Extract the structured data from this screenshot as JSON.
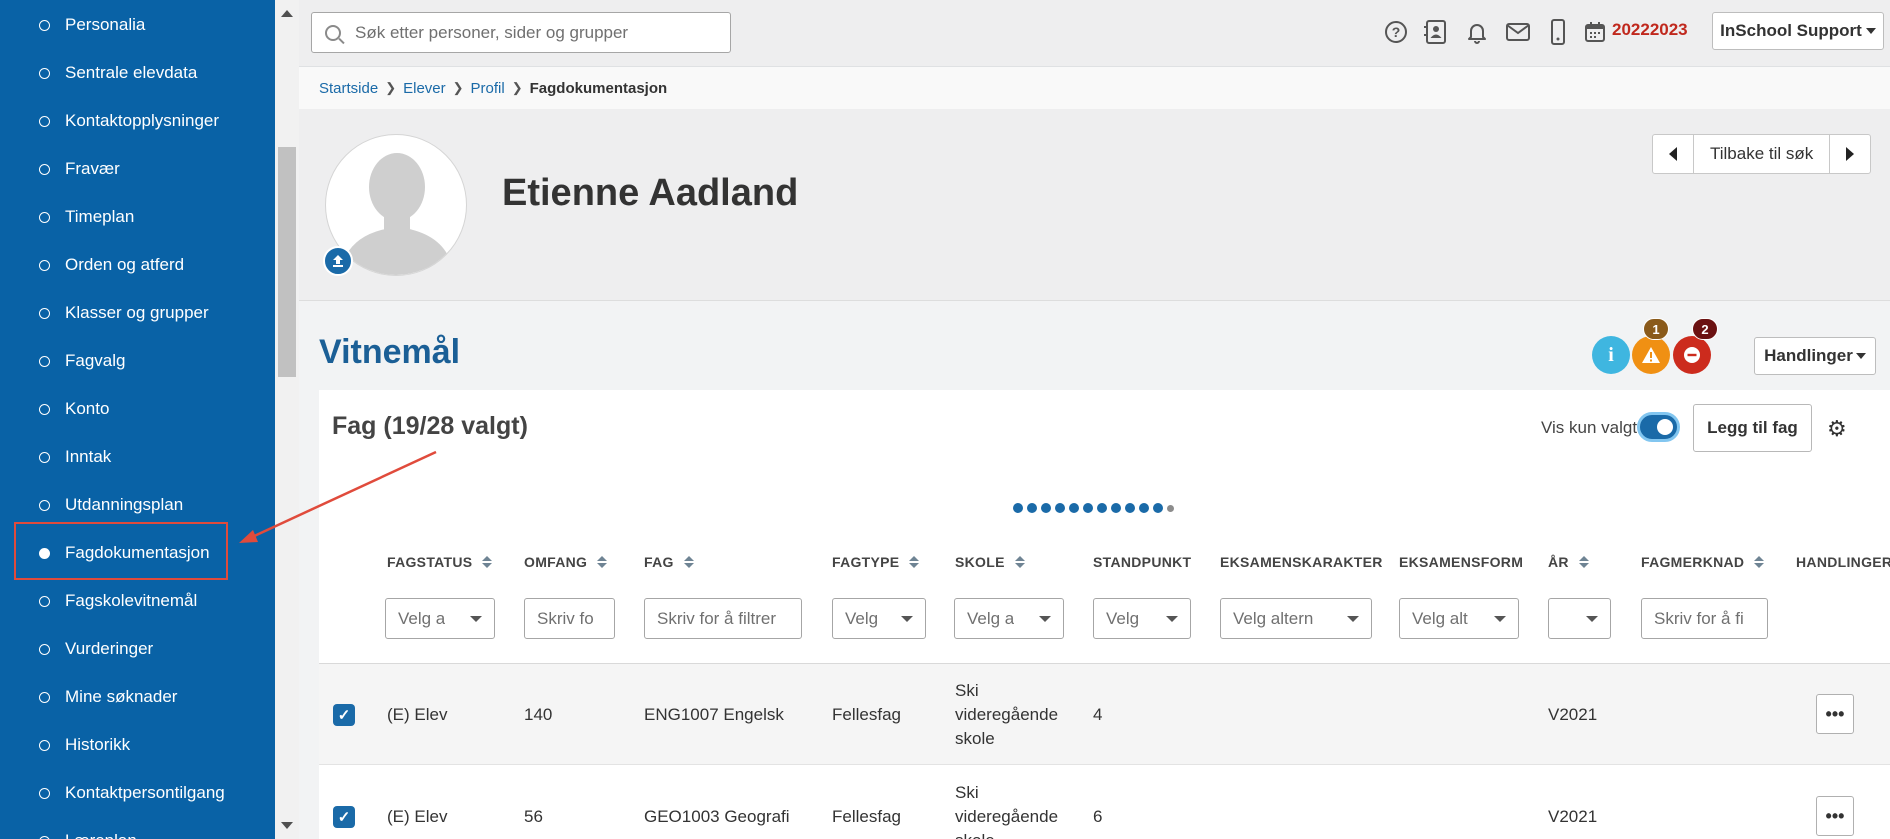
{
  "sidebar": {
    "items": [
      {
        "label": "Personalia",
        "active": false
      },
      {
        "label": "Sentrale elevdata",
        "active": false
      },
      {
        "label": "Kontaktopplysninger",
        "active": false
      },
      {
        "label": "Fravær",
        "active": false
      },
      {
        "label": "Timeplan",
        "active": false
      },
      {
        "label": "Orden og atferd",
        "active": false
      },
      {
        "label": "Klasser og grupper",
        "active": false
      },
      {
        "label": "Fagvalg",
        "active": false
      },
      {
        "label": "Konto",
        "active": false
      },
      {
        "label": "Inntak",
        "active": false
      },
      {
        "label": "Utdanningsplan",
        "active": false
      },
      {
        "label": "Fagdokumentasjon",
        "active": true
      },
      {
        "label": "Fagskolevitnemål",
        "active": false
      },
      {
        "label": "Vurderinger",
        "active": false
      },
      {
        "label": "Mine søknader",
        "active": false
      },
      {
        "label": "Historikk",
        "active": false
      },
      {
        "label": "Kontaktpersontilgang",
        "active": false
      },
      {
        "label": "Læreplan",
        "active": false
      }
    ]
  },
  "topbar": {
    "search_placeholder": "Søk etter personer, sider og grupper",
    "icons": [
      "help-icon",
      "contact-card-icon",
      "bell-icon",
      "mail-icon",
      "mobile-icon",
      "calendar-icon"
    ],
    "school_year": "20222023",
    "user_menu": "InSchool Support"
  },
  "breadcrumb": {
    "items": [
      "Startside",
      "Elever",
      "Profil"
    ],
    "current": "Fagdokumentasjon"
  },
  "profile": {
    "name": "Etienne Aadland",
    "back_to_search": "Tilbake til søk"
  },
  "section": {
    "title": "Vitnemål",
    "warning_count": "1",
    "error_count": "2",
    "actions_label": "Handlinger"
  },
  "card": {
    "title": "Fag (19/28 valgt)",
    "toggle_label": "Vis kun valgte",
    "add_button": "Legg til fag"
  },
  "table": {
    "columns": [
      "FAGSTATUS",
      "OMFANG",
      "FAG",
      "FAGTYPE",
      "SKOLE",
      "STANDPUNKT",
      "EKSAMENSKARAKTER",
      "EKSAMENSFORM",
      "ÅR",
      "FAGMERKNAD",
      "HANDLINGER"
    ],
    "filters": [
      "Velg a",
      "Skriv fo",
      "Skriv for å filtrer",
      "Velg",
      "Velg a",
      "Velg",
      "Velg altern",
      "Velg alt",
      "",
      "Skriv for å fi"
    ],
    "rows": [
      {
        "fagstatus": "(E) Elev",
        "omfang": "140",
        "fag": "ENG1007 Engelsk",
        "fagtype": "Fellesfag",
        "skole": "Ski videregående skole",
        "standpunkt": "4",
        "eksamenskarakter": "",
        "eksamensform": "",
        "aar": "V2021",
        "fagmerknad": ""
      },
      {
        "fagstatus": "(E) Elev",
        "omfang": "56",
        "fag": "GEO1003 Geografi",
        "fagtype": "Fellesfag",
        "skole": "Ski videregående skole",
        "standpunkt": "6",
        "eksamenskarakter": "",
        "eksamensform": "",
        "aar": "V2021",
        "fagmerknad": ""
      }
    ]
  },
  "colors": {
    "sidebar": "#0962a6",
    "accent": "#1a6aa8",
    "year": "#c0281d",
    "info": "#3fb6e0",
    "warning": "#f09013",
    "error": "#cc2b1d",
    "annotation": "#e04b3c"
  }
}
